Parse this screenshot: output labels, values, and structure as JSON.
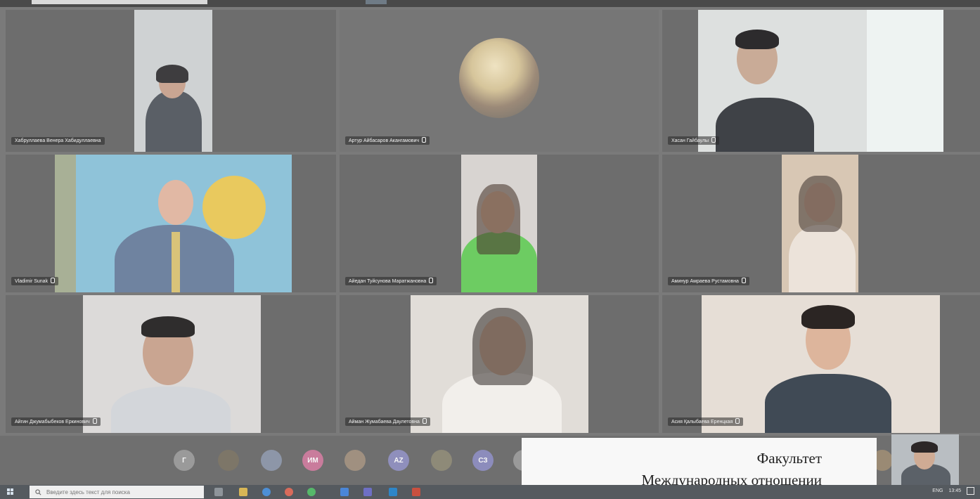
{
  "participants": [
    {
      "name": "Хабруллаева Венера Хабидуллаевна"
    },
    {
      "name": "Артур Айбасаров Акангамович"
    },
    {
      "name": "Хасан Гайбаулы"
    },
    {
      "name": "Vladimir Sunak"
    },
    {
      "name": "Айедан Туйсунова Маратжановна"
    },
    {
      "name": "Аминур Амраева Рустамовна"
    },
    {
      "name": "Айгин Джумабыбеков Еркинович"
    },
    {
      "name": "Айман Жумабаева Даулетовна"
    },
    {
      "name": "Асия Қалыбаева Еренцкая"
    }
  ],
  "avatar_bar": {
    "items": [
      {
        "initials": "Г",
        "color": "#9a9a9a",
        "icon": "initials"
      },
      {
        "initials": "",
        "color": "#7d7668",
        "icon": "photo"
      },
      {
        "initials": "",
        "color": "#8d96a8",
        "icon": "photo"
      },
      {
        "initials": "ИМ",
        "color": "#c97c9c",
        "icon": "initials"
      },
      {
        "initials": "",
        "color": "#a09080",
        "icon": "photo"
      },
      {
        "initials": "AZ",
        "color": "#8f8fbc",
        "icon": "initials"
      },
      {
        "initials": "",
        "color": "#8e8a78",
        "icon": "photo"
      },
      {
        "initials": "СЗ",
        "color": "#8c8cbc",
        "icon": "initials"
      }
    ]
  },
  "caption": {
    "line1": "Факультет",
    "line2": "Международных отношении"
  },
  "taskbar": {
    "search_placeholder": "Введите здесь текст для поиска",
    "tray_lang": "ENG",
    "tray_time": "13:45"
  },
  "colors": {
    "tile_bg": "#6d6d6d",
    "caption_bg": "#f8f8f8",
    "taskbar_bg": "#555a5f"
  }
}
